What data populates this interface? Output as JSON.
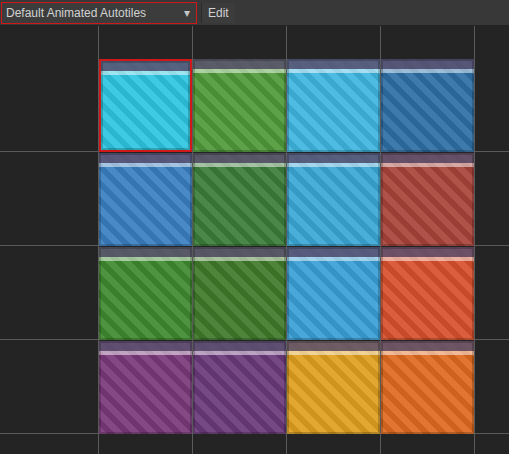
{
  "toolbar": {
    "palette_dropdown": {
      "label": "Default Animated Autotiles",
      "arrow": "▾",
      "outlined": true
    },
    "edit_button": "Edit"
  },
  "tiles": [
    {
      "color": "#2ec6e0",
      "selected": true
    },
    {
      "color": "#4f9a3a",
      "selected": false
    },
    {
      "color": "#3fb6e0",
      "selected": false
    },
    {
      "color": "#2f6fa6",
      "selected": false
    },
    {
      "color": "#3a7fc0",
      "selected": false
    },
    {
      "color": "#3b7d3a",
      "selected": false
    },
    {
      "color": "#3aa8d6",
      "selected": false
    },
    {
      "color": "#a8443a",
      "selected": false
    },
    {
      "color": "#3f8a2f",
      "selected": false
    },
    {
      "color": "#3f7a2a",
      "selected": false
    },
    {
      "color": "#3a9fd6",
      "selected": false
    },
    {
      "color": "#d8502e",
      "selected": false
    },
    {
      "color": "#7a3a7a",
      "selected": false
    },
    {
      "color": "#6a3a7a",
      "selected": false
    },
    {
      "color": "#e0a020",
      "selected": false
    },
    {
      "color": "#e06a20",
      "selected": false
    }
  ]
}
